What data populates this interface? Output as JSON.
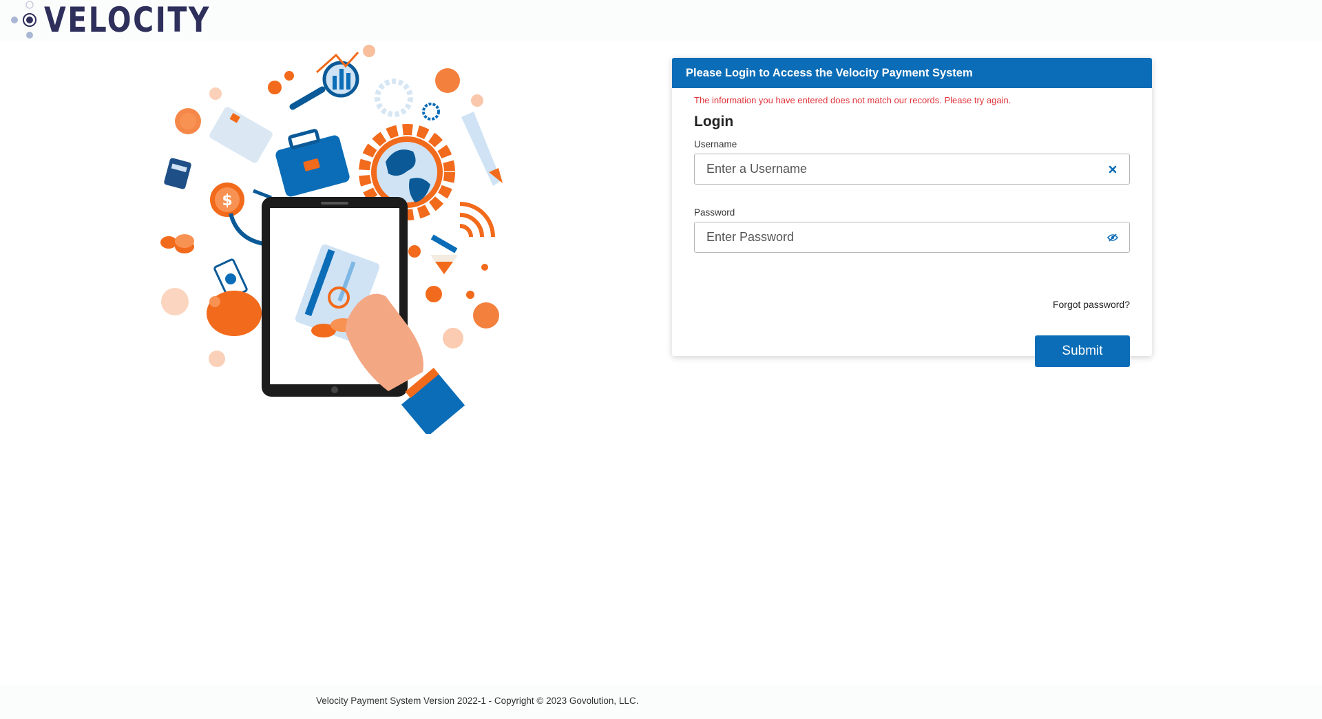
{
  "header": {
    "logo_text": "VELOCITY"
  },
  "login_card": {
    "title": "Please Login to Access the Velocity Payment System",
    "error_message": "The information you have entered does not match our records. Please try again.",
    "heading": "Login",
    "username": {
      "label": "Username",
      "placeholder": "Enter a Username",
      "value": "",
      "icon": "clear-icon"
    },
    "password": {
      "label": "Password",
      "placeholder": "Enter Password",
      "value": "",
      "icon": "eye-icon"
    },
    "forgot_password": "Forgot password?",
    "submit_label": "Submit"
  },
  "footer": {
    "text": "Velocity Payment System Version 2022-1 - Copyright © 2023 Govolution, LLC."
  },
  "colors": {
    "primary": "#0b6db7",
    "error": "#e0333a",
    "logo": "#2e2f5b",
    "accent_orange": "#f26a1b"
  }
}
